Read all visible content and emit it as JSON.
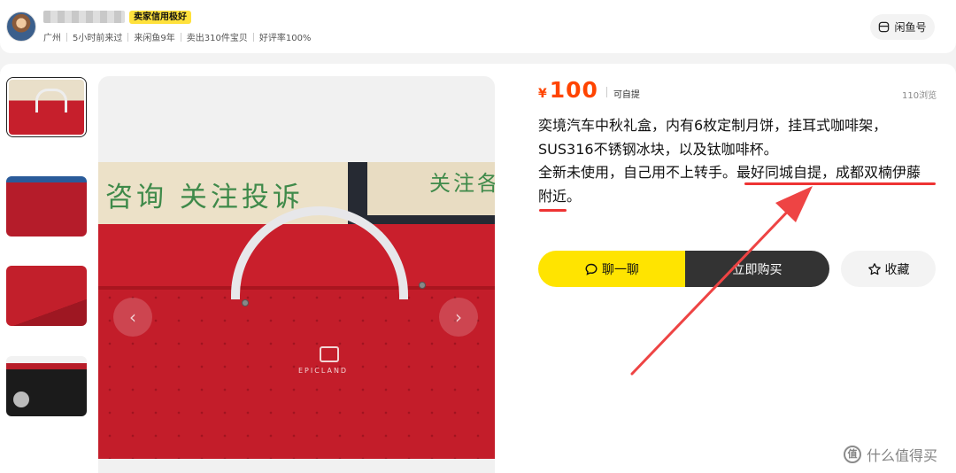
{
  "seller": {
    "credit_badge": "卖家信用极好",
    "meta": [
      "广州",
      "5小时前来过",
      "来闲鱼9年",
      "卖出310件宝贝",
      "好评率100%"
    ],
    "shop_label": "闲鱼号"
  },
  "gallery": {
    "thumbnail_count": 4,
    "active_index": 0,
    "bag_text": "咨询 关注投诉",
    "bag_text_2": "关注各",
    "brand_text": "EPICLAND"
  },
  "product": {
    "currency": "¥",
    "price": "100",
    "pickup": "可自提",
    "views": "110浏览",
    "description": {
      "line1": "奕境汽车中秋礼盒，内有6枚定制月饼，挂耳式咖啡架，",
      "line2": "SUS316不锈钢冰块，以及钛咖啡杯。",
      "line3_plain": "全新未使用，自己用不上转手。",
      "line3_highlight": "最好同城自提，成都双楠伊藤",
      "line4": "附近。"
    }
  },
  "actions": {
    "chat": "聊一聊",
    "buy": "立即购买",
    "favorite": "收藏"
  },
  "icons": {
    "shop": "shop-icon",
    "chat": "chat-bubble-icon",
    "favorite": "star-icon",
    "prev": "chevron-left-icon",
    "next": "chevron-right-icon"
  },
  "colors": {
    "price": "#ff4400",
    "chat_button": "#ffe400",
    "buy_button": "#333333",
    "annotation": "#ee3333",
    "badge": "#ffe13c"
  },
  "watermark": "什么值得买"
}
